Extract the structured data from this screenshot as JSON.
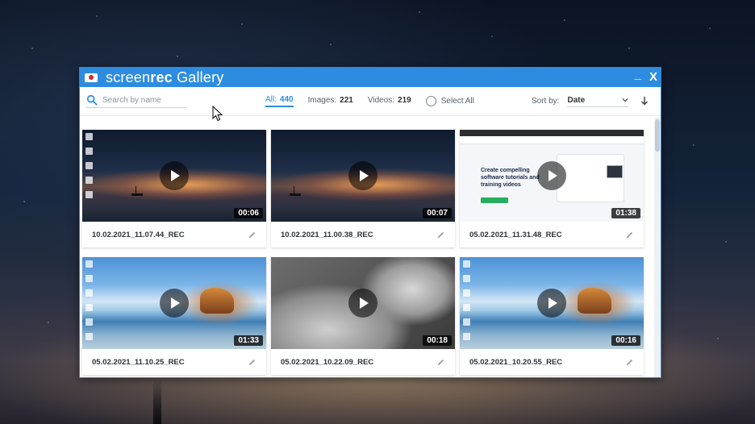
{
  "window": {
    "title_prefix": "screen",
    "title_bold": "rec",
    "title_suffix": " Gallery",
    "minimize_label": "_",
    "close_label": "X"
  },
  "toolbar": {
    "search_placeholder": "Search by name",
    "filters": [
      {
        "label": "All:",
        "count": "440",
        "active": true
      },
      {
        "label": "Images:",
        "count": "221",
        "active": false
      },
      {
        "label": "Videos:",
        "count": "219",
        "active": false
      }
    ],
    "select_all_label": "Select All",
    "sort_label": "Sort by:",
    "sort_value": "Date"
  },
  "recordings": [
    {
      "name": "10.02.2021_11.07.44_REC",
      "duration": "00:06",
      "thumb": "night-desktop"
    },
    {
      "name": "10.02.2021_11.00.38_REC",
      "duration": "00:07",
      "thumb": "night"
    },
    {
      "name": "05.02.2021_11.31.48_REC",
      "duration": "01:38",
      "thumb": "webpage"
    },
    {
      "name": "05.02.2021_11.10.25_REC",
      "duration": "01:33",
      "thumb": "beach"
    },
    {
      "name": "05.02.2021_10.22.09_REC",
      "duration": "00:18",
      "thumb": "baby"
    },
    {
      "name": "05.02.2021_10.20.55_REC",
      "duration": "00:16",
      "thumb": "beach"
    }
  ],
  "webpage_thumb": {
    "heading": "Create compelling software tutorials and training videos"
  },
  "colors": {
    "accent": "#2e8ce0",
    "titlebar": "#2e8ce0",
    "logo_red": "#d6282b"
  }
}
